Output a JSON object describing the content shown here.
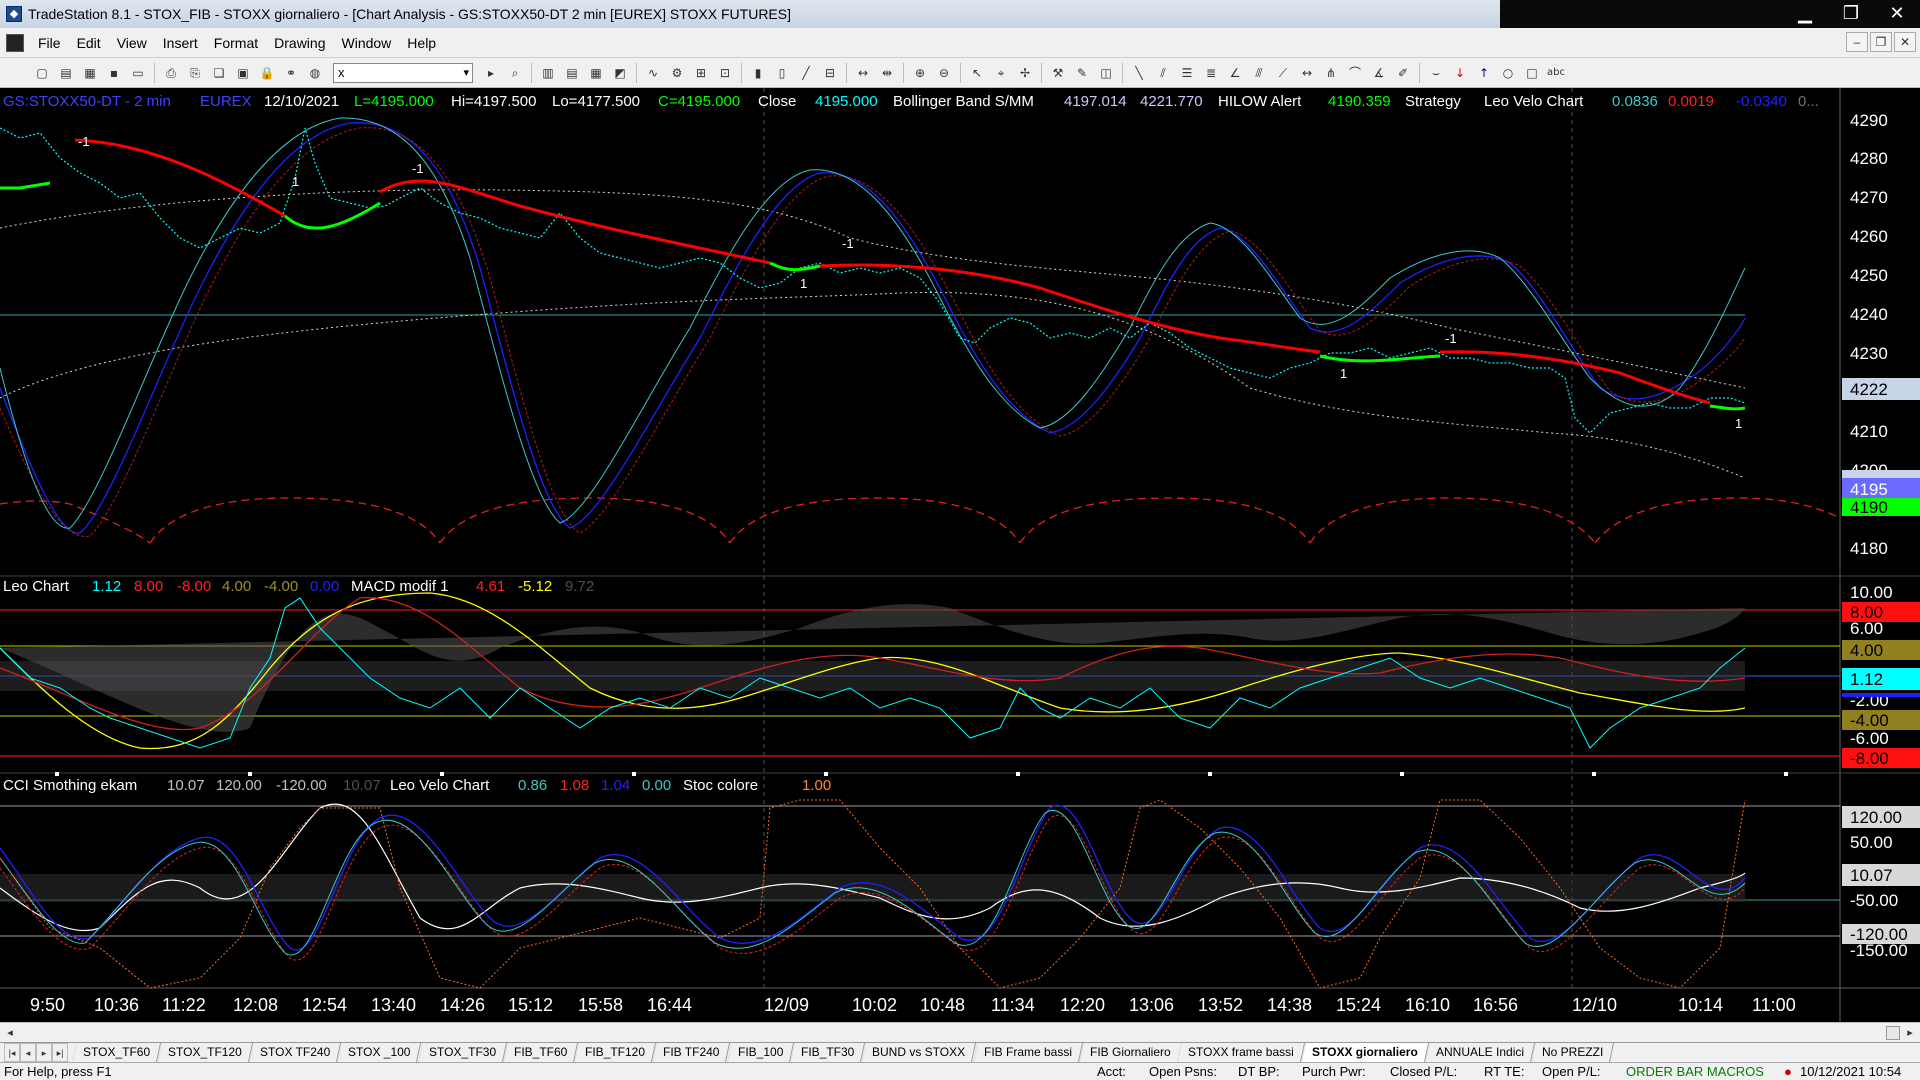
{
  "window": {
    "title": "TradeStation 8.1 - STOX_FIB - STOXX giornaliero - [Chart Analysis - GS:STOXX50-DT  2 min  [EUREX] STOXX FUTURES]"
  },
  "menu": [
    "File",
    "Edit",
    "View",
    "Insert",
    "Format",
    "Drawing",
    "Window",
    "Help"
  ],
  "toolbar": {
    "symbol_value": "x"
  },
  "price_panel": {
    "header": {
      "symbol": "GS:STOXX50-DT - 2 min",
      "exchange": "EUREX",
      "date": "12/10/2021",
      "low_open": "L=4195.000",
      "hi": "Hi=4197.500",
      "lo": "Lo=4177.500",
      "close_val": "C=4195.000",
      "close_label": "Close",
      "close_num": "4195.000",
      "bb_label": "Bollinger Band S/MM",
      "bb1": "4197.014",
      "bb2": "4221.770",
      "hilow_label": "HILOW Alert",
      "hilow_val": "4190.359",
      "strategy_label": "Strategy",
      "leovelo_label": "Leo Velo Chart",
      "lv1": "0.0836",
      "lv2": "0.0019",
      "lv3": "-0.0340",
      "lv4": "0..."
    },
    "price_ticks": [
      "4290",
      "4280",
      "4270",
      "4260",
      "4250",
      "4240",
      "4230",
      "4210",
      "4200",
      "4180"
    ],
    "price_flags": {
      "bb_upper": "4222",
      "last": "4195",
      "hilow": "4190",
      "last_hidden": "4197"
    },
    "strategy_labels": [
      "-1",
      "1",
      "1",
      "-1",
      "-1",
      "1",
      "-1",
      "1",
      "1",
      "-1",
      "1"
    ]
  },
  "macd_panel": {
    "header": {
      "leo_label": "Leo Chart",
      "v1": "1.12",
      "v2": "8.00",
      "v3": "-8.00",
      "v4": "4.00",
      "v5": "-4.00",
      "v6": "0.00",
      "macd_label": "MACD modif 1",
      "m1": "4.61",
      "m2": "-5.12",
      "m3": "9.72"
    },
    "ticks": [
      "10.00",
      "6.00",
      "-2.00",
      "-6.00"
    ],
    "flags": {
      "f1": "8.00",
      "f2": "4.00",
      "f3": "1.12",
      "f4": "-4.00",
      "f5": "-8.00"
    }
  },
  "cci_panel": {
    "header": {
      "cci_label": "CCI Smothing ekam",
      "c1": "10.07",
      "c2": "120.00",
      "c3": "-120.00",
      "c4": "10.07",
      "leovelo_label": "Leo Velo Chart",
      "l1": "0.86",
      "l2": "1.08",
      "l3": "1.04",
      "l4": "0.00",
      "stoc_label": "Stoc colore",
      "s1": "1.00"
    },
    "ticks": [
      "50.00",
      "-50.00",
      "-150.00"
    ],
    "flags": {
      "f1": "120.00",
      "f2": "10.07",
      "f3": "-120.00"
    }
  },
  "time_axis": [
    "9:50",
    "10:36",
    "11:22",
    "12:08",
    "12:54",
    "13:40",
    "14:26",
    "15:12",
    "15:58",
    "16:44",
    "12/09",
    "10:02",
    "10:48",
    "11:34",
    "12:20",
    "13:06",
    "13:52",
    "14:38",
    "15:24",
    "16:10",
    "16:56",
    "12/10",
    "10:14",
    "11:00"
  ],
  "tabs": [
    "STOX_TF60",
    "STOX_TF120",
    "STOX TF240",
    "STOX _100",
    "STOX_TF30",
    "FIB_TF60",
    "FIB_TF120",
    "FIB TF240",
    "FIB_100",
    "FIB_TF30",
    "BUND vs STOXX",
    "FIB Frame bassi",
    "FIB Giornaliero",
    "STOXX frame bassi",
    "STOXX giornaliero",
    "ANNUALE Indici",
    "No PREZZI"
  ],
  "active_tab": "STOXX giornaliero",
  "status": {
    "help": "For Help, press F1",
    "acct": "Acct:",
    "open_psns": "Open Psns:",
    "dtbp": "DT BP:",
    "purch": "Purch Pwr:",
    "closed": "Closed P/L:",
    "rtte": "RT TE:",
    "openpl": "Open P/L:",
    "macros": "ORDER BAR MACROS",
    "datetime": "10/12/2021 10:54"
  },
  "colors": {
    "cyan": "#00ffff",
    "red": "#ff0000",
    "green": "#00ff00",
    "blue": "#2020ff",
    "yellow": "#ffff00",
    "teal": "#3cc8c8",
    "bg": "#000000"
  }
}
